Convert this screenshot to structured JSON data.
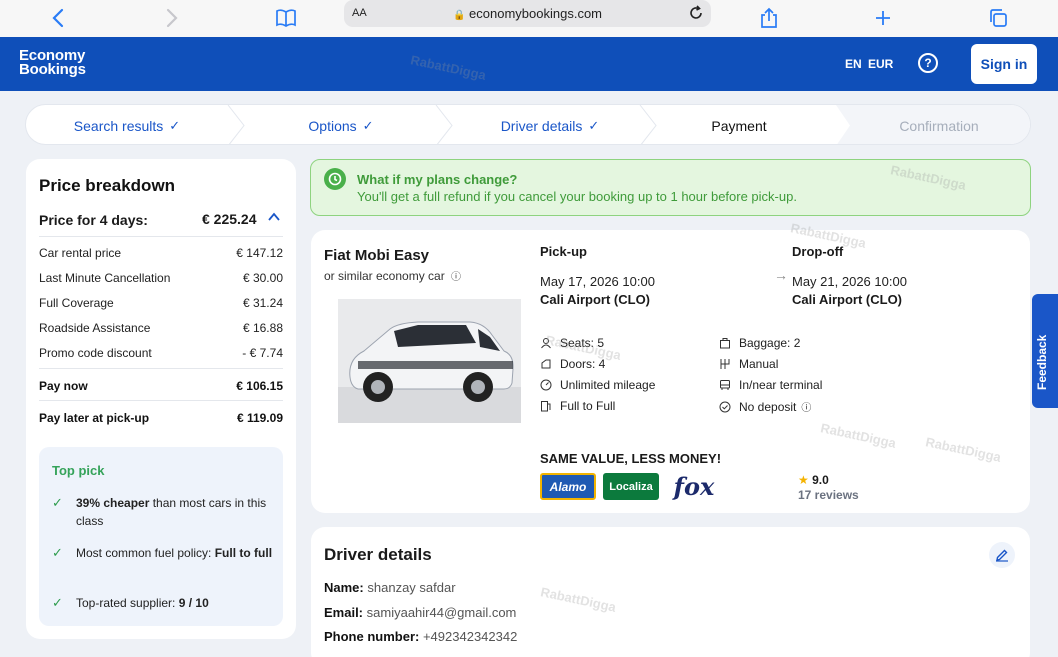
{
  "browser": {
    "text_size_label": "AA",
    "url": "economybookings.com"
  },
  "header": {
    "logo_line1": "Economy",
    "logo_line2": "Bookings",
    "language": "EN",
    "currency": "EUR",
    "help": "?",
    "signin": "Sign in"
  },
  "steps": [
    {
      "label": "Search results",
      "state": "done"
    },
    {
      "label": "Options",
      "state": "done"
    },
    {
      "label": "Driver details",
      "state": "done"
    },
    {
      "label": "Payment",
      "state": "active"
    },
    {
      "label": "Confirmation",
      "state": "pending"
    }
  ],
  "price": {
    "title": "Price breakdown",
    "total_label": "Price for 4 days:",
    "total_value": "€ 225.24",
    "rows": [
      {
        "label": "Car rental price",
        "value": "€ 147.12"
      },
      {
        "label": "Last Minute Cancellation",
        "value": "€ 30.00"
      },
      {
        "label": "Full Coverage",
        "value": "€ 31.24"
      },
      {
        "label": "Roadside Assistance",
        "value": "€ 16.88"
      },
      {
        "label": "Promo code discount",
        "value": "- € 7.74"
      }
    ],
    "pay_now_label": "Pay now",
    "pay_now_value": "€ 106.15",
    "pay_later_label": "Pay later at pick-up",
    "pay_later_value": "€ 119.09"
  },
  "top_pick": {
    "title": "Top pick",
    "item1_bold": "39% cheaper",
    "item1_rest": " than most cars in this class",
    "item2_rest": "Most common fuel policy: ",
    "item2_bold": "Full to full",
    "item3_rest": "Top-rated supplier: ",
    "item3_bold": "9 / 10"
  },
  "refund": {
    "title": "What if my plans change?",
    "text": "You'll get a full refund if you cancel your booking up to 1 hour before pick-up."
  },
  "car": {
    "name": "Fiat Mobi Easy",
    "similar": "or similar economy car",
    "pickup_label": "Pick-up",
    "pickup_date": "May 17, 2026 10:00",
    "pickup_location": "Cali Airport (CLO)",
    "dropoff_label": "Drop-off",
    "dropoff_date": "May 21, 2026 10:00",
    "dropoff_location": "Cali Airport (CLO)",
    "features_left": [
      "Seats: 5",
      "Doors: 4",
      "Unlimited mileage",
      "Full to Full"
    ],
    "features_right": [
      "Baggage: 2",
      "Manual",
      "In/near terminal",
      "No deposit"
    ],
    "value_title": "SAME VALUE, LESS MONEY!",
    "brands": [
      "Alamo",
      "Localiza",
      "fox"
    ],
    "rating": "9.0",
    "reviews": "17 reviews"
  },
  "driver": {
    "title": "Driver details",
    "name_label": "Name:",
    "name_value": "shanzay safdar",
    "email_label": "Email:",
    "email_value": "samiyaahir44@gmail.com",
    "phone_label": "Phone number:",
    "phone_value": "+492342342342"
  },
  "feedback": "Feedback",
  "watermark": "RabattDigga",
  "colors": {
    "brand_blue": "#0f4fb9",
    "link_blue": "#1a56c8",
    "success_green": "#3f9b3a",
    "banner_bg": "#e4f6df"
  }
}
